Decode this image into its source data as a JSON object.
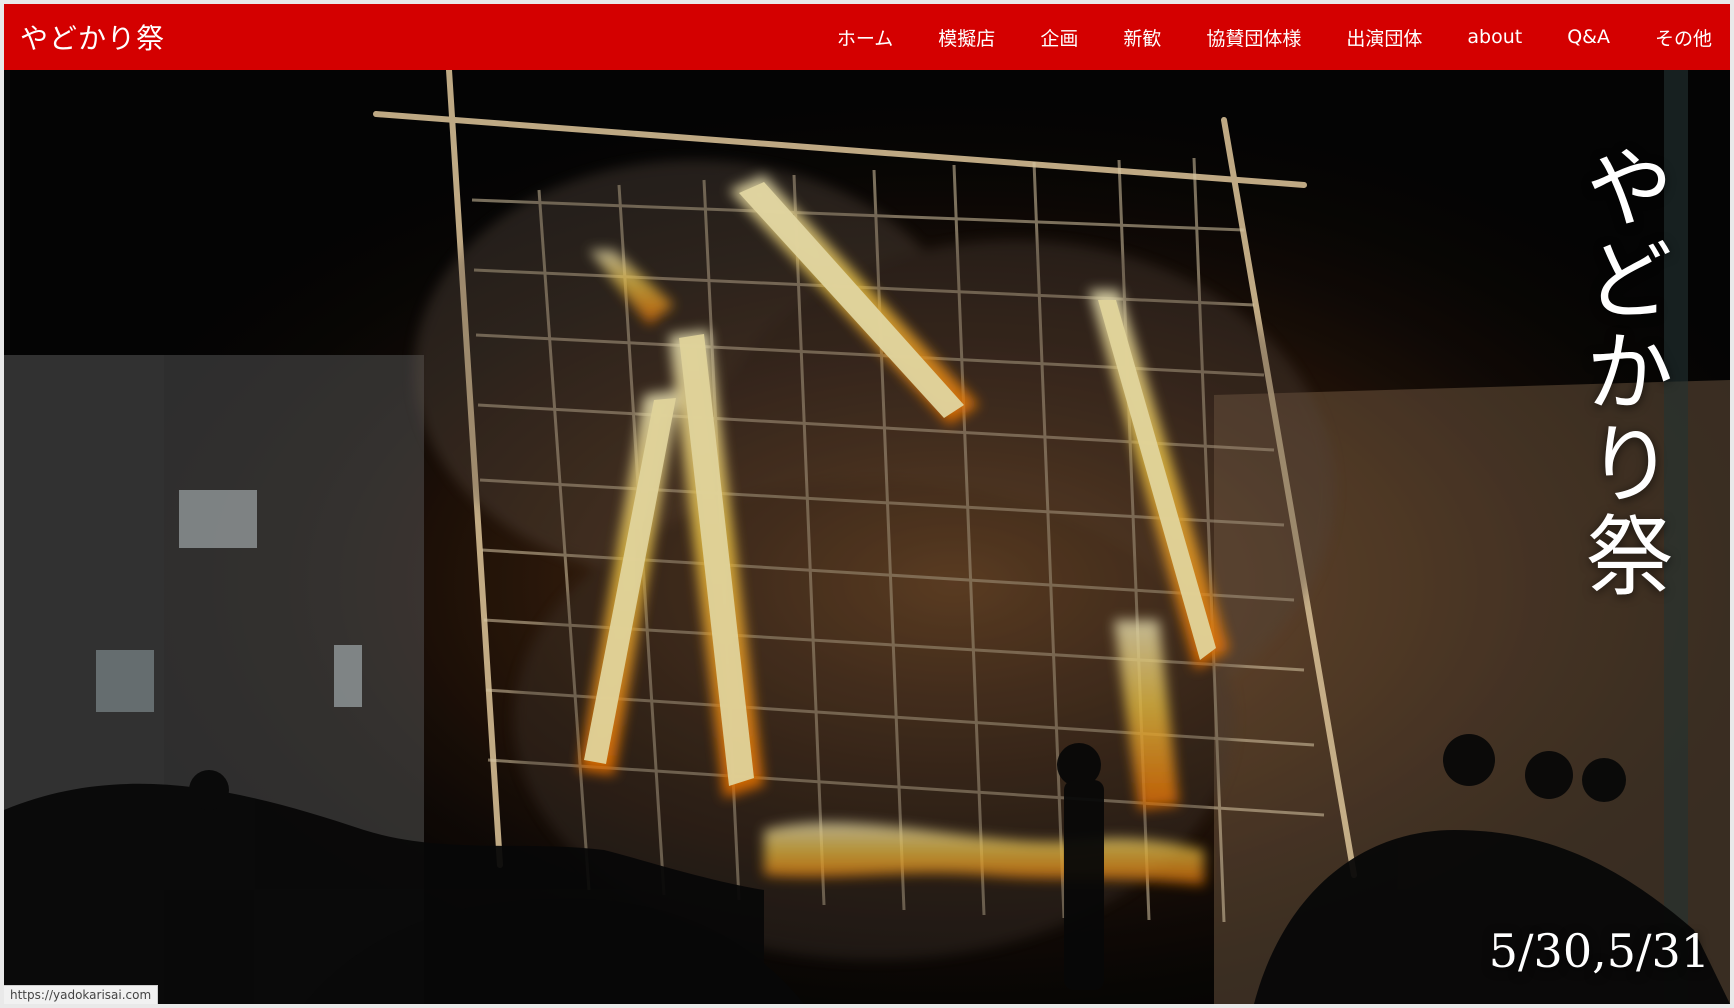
{
  "site": {
    "brand": "やどかり祭"
  },
  "nav": {
    "items": [
      {
        "label": "ホーム"
      },
      {
        "label": "模擬店"
      },
      {
        "label": "企画"
      },
      {
        "label": "新歓"
      },
      {
        "label": "協賛団体様"
      },
      {
        "label": "出演団体"
      },
      {
        "label": "about"
      },
      {
        "label": "Q&A"
      },
      {
        "label": "その他"
      }
    ]
  },
  "hero": {
    "title": "やどかり祭",
    "dates": "5/30,5/31"
  },
  "status_bar": {
    "url": "https://yadokarisai.com"
  },
  "colors": {
    "header_red": "#d40000",
    "text": "#ffffff"
  }
}
